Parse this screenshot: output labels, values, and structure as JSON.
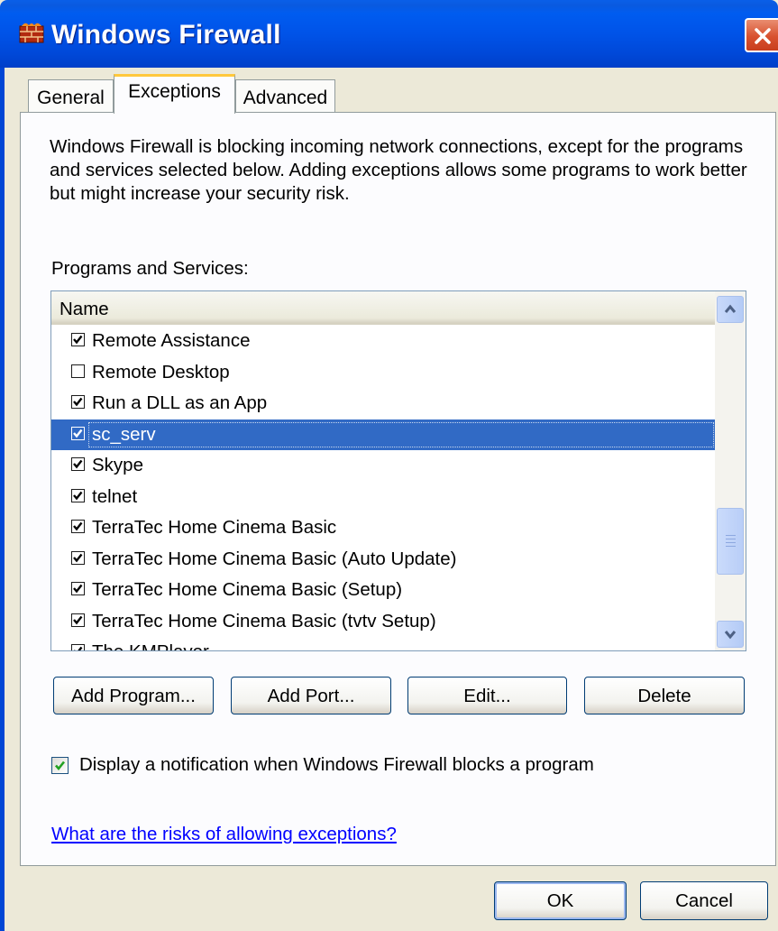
{
  "window": {
    "title": "Windows Firewall"
  },
  "tabs": [
    {
      "label": "General",
      "active": false
    },
    {
      "label": "Exceptions",
      "active": true
    },
    {
      "label": "Advanced",
      "active": false
    }
  ],
  "exceptions": {
    "description": "Windows Firewall is blocking incoming network connections, except for the programs and services selected below. Adding exceptions allows some programs to work better but might increase your security risk.",
    "list_label": "Programs and Services:",
    "column_header": "Name",
    "items": [
      {
        "label": "Remote Assistance",
        "checked": true,
        "selected": false
      },
      {
        "label": "Remote Desktop",
        "checked": false,
        "selected": false
      },
      {
        "label": "Run a DLL as an App",
        "checked": true,
        "selected": false
      },
      {
        "label": "sc_serv",
        "checked": true,
        "selected": true
      },
      {
        "label": "Skype",
        "checked": true,
        "selected": false
      },
      {
        "label": "telnet",
        "checked": true,
        "selected": false
      },
      {
        "label": "TerraTec Home Cinema Basic",
        "checked": true,
        "selected": false
      },
      {
        "label": "TerraTec Home Cinema Basic (Auto Update)",
        "checked": true,
        "selected": false
      },
      {
        "label": "TerraTec Home Cinema Basic (Setup)",
        "checked": true,
        "selected": false
      },
      {
        "label": "TerraTec Home Cinema Basic (tvtv Setup)",
        "checked": true,
        "selected": false
      },
      {
        "label": "The KMPlayer",
        "checked": true,
        "selected": false
      }
    ],
    "buttons": {
      "add_program": "Add Program...",
      "add_port": "Add Port...",
      "edit": "Edit...",
      "delete": "Delete"
    },
    "notification": {
      "label": "Display a notification when Windows Firewall blocks a program",
      "checked": true
    },
    "help_link": "What are the risks of allowing exceptions?"
  },
  "footer": {
    "ok": "OK",
    "cancel": "Cancel"
  },
  "colors": {
    "titlebar": "#0053E8",
    "selection": "#316AC5",
    "link": "#0000FF",
    "active_tab_accent": "#FFC83C",
    "dialog_bg": "#ECE9D8"
  },
  "icons": {
    "app": "firewall-brick-icon",
    "close": "close-icon",
    "scroll_up": "chevron-up-icon",
    "scroll_down": "chevron-down-icon",
    "check": "checkmark-icon"
  }
}
